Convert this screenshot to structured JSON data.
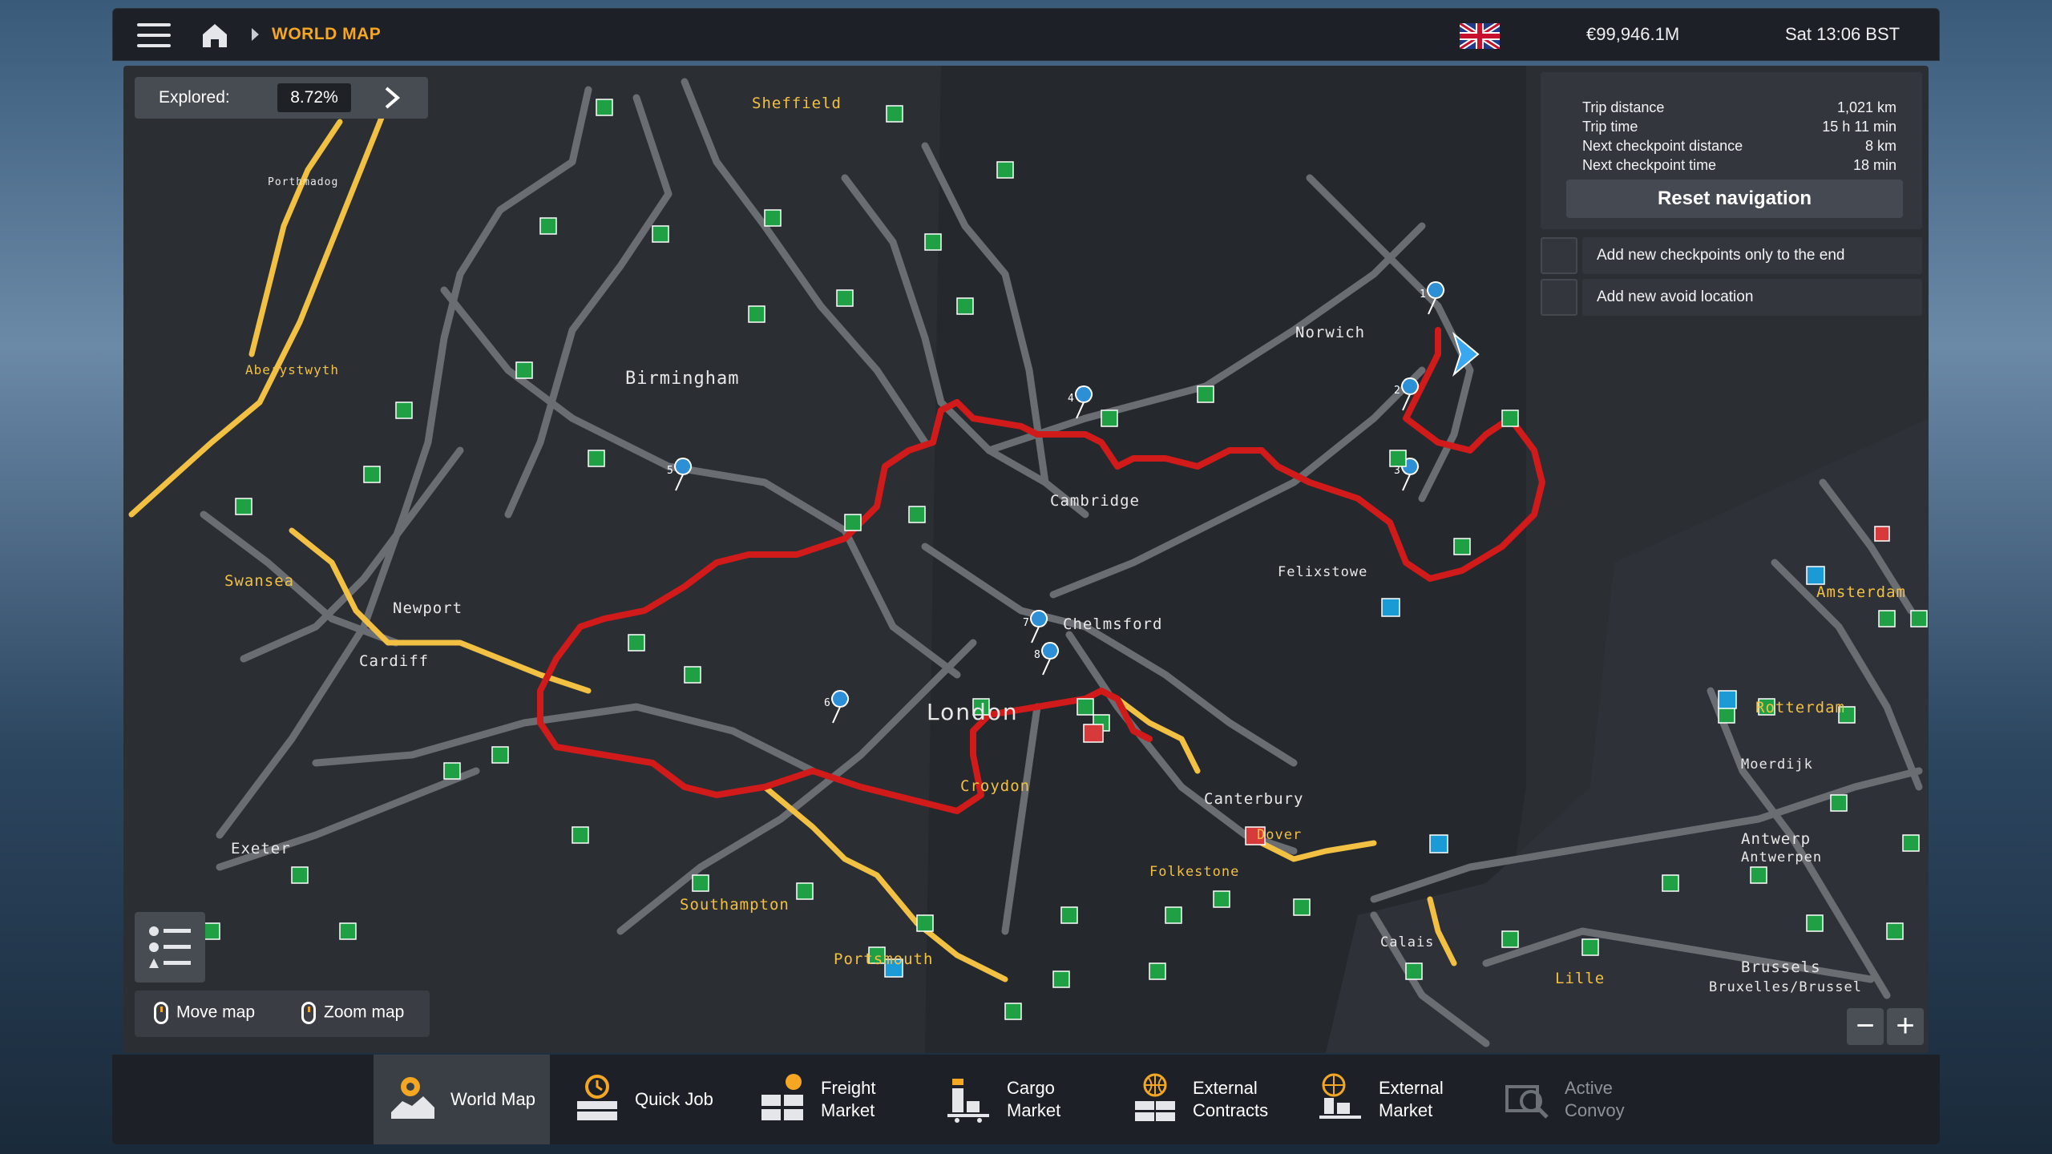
{
  "topbar": {
    "breadcrumb": "WORLD MAP",
    "money": "€99,946.1M",
    "clock": "Sat 13:06 BST"
  },
  "explored": {
    "label": "Explored:",
    "value": "8.72%"
  },
  "navigation": {
    "rows": [
      {
        "key": "Trip distance",
        "value": "1,021 km"
      },
      {
        "key": "Trip time",
        "value": "15 h 11 min"
      },
      {
        "key": "Next checkpoint distance",
        "value": "8 km"
      },
      {
        "key": "Next checkpoint time",
        "value": "18 min"
      }
    ],
    "reset_label": "Reset navigation",
    "options": [
      "Add new checkpoints only to the end",
      "Add new avoid location"
    ]
  },
  "hints": {
    "move": "Move map",
    "zoom": "Zoom map"
  },
  "cities": [
    "Sheffield",
    "Porthmadog",
    "Aberystwyth",
    "Birmingham",
    "Swansea",
    "Newport",
    "Cardiff",
    "Exeter",
    "Southampton",
    "Portsmouth",
    "Cambridge",
    "Chelmsford",
    "London",
    "Croydon",
    "Canterbury",
    "Dover",
    "Folkestone",
    "Norwich",
    "Felixstowe",
    "Amsterdam",
    "Rotterdam",
    "Moerdijk",
    "Antwerpen",
    "Antwerp",
    "Brussels",
    "Bruxelles/Brussel",
    "Calais",
    "Lille"
  ],
  "checkpoints": [
    "1",
    "2",
    "3",
    "4",
    "5",
    "6",
    "7",
    "8"
  ],
  "tabs": [
    {
      "label1": "World Map",
      "label2": ""
    },
    {
      "label1": "Quick Job",
      "label2": ""
    },
    {
      "label1": "Freight",
      "label2": "Market"
    },
    {
      "label1": "Cargo",
      "label2": "Market"
    },
    {
      "label1": "External",
      "label2": "Contracts"
    },
    {
      "label1": "External",
      "label2": "Market"
    },
    {
      "label1": "Active",
      "label2": "Convoy"
    }
  ],
  "colors": {
    "accent": "#f5a623",
    "route": "#d11a1a",
    "road": "#6a6d72",
    "highlight_road": "#f2c043"
  }
}
